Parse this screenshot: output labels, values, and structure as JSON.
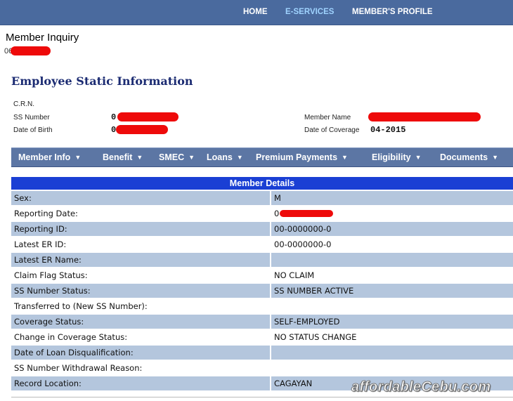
{
  "nav": {
    "home": "HOME",
    "eservices": "E-SERVICES",
    "profile": "MEMBER'S PROFILE",
    "active_color": "#9fd3ff"
  },
  "inquiry": {
    "title": "Member Inquiry",
    "number_prefix": "06"
  },
  "static_info": {
    "title": "Employee Static Information",
    "crn_label": "C.R.N.",
    "ss_label": "SS Number",
    "ss_prefix": "0",
    "dob_label": "Date of Birth",
    "dob_prefix": "0",
    "member_name_label": "Member Name",
    "coverage_label": "Date of Coverage",
    "coverage_value": "04-2015"
  },
  "menu": [
    {
      "label": "Member Info"
    },
    {
      "label": "Benefit"
    },
    {
      "label": "SMEC"
    },
    {
      "label": "Loans"
    },
    {
      "label": "Premium Payments"
    },
    {
      "label": "Eligibility"
    },
    {
      "label": "Documents"
    }
  ],
  "details": {
    "header": "Member Details",
    "rows": [
      {
        "label": "Sex:",
        "value": "M"
      },
      {
        "label": "Reporting Date:",
        "value": "0"
      },
      {
        "label": "Reporting ID:",
        "value": "00-0000000-0"
      },
      {
        "label": "Latest ER ID:",
        "value": "00-0000000-0"
      },
      {
        "label": "Latest ER Name:",
        "value": ""
      },
      {
        "label": "Claim Flag Status:",
        "value": "NO CLAIM"
      },
      {
        "label": "SS Number Status:",
        "value": "SS NUMBER ACTIVE"
      },
      {
        "label": "Transferred to (New SS Number):",
        "value": ""
      },
      {
        "label": "Coverage Status:",
        "value": "SELF-EMPLOYED"
      },
      {
        "label": "Change in Coverage Status:",
        "value": "NO STATUS CHANGE"
      },
      {
        "label": "Date of Loan Disqualification:",
        "value": ""
      },
      {
        "label": "SS Number Withdrawal Reason:",
        "value": ""
      },
      {
        "label": "Record Location:",
        "value": "CAGAYAN"
      }
    ]
  },
  "watermark": "affordableCebu.com",
  "colors": {
    "nav_bg": "#4a6a9e",
    "menu_bg": "#5c76a4",
    "header_bg": "#1a3fd4",
    "row_alt": "#b4c6dd",
    "redaction": "#ee0a0a",
    "title": "#1b2b72"
  }
}
